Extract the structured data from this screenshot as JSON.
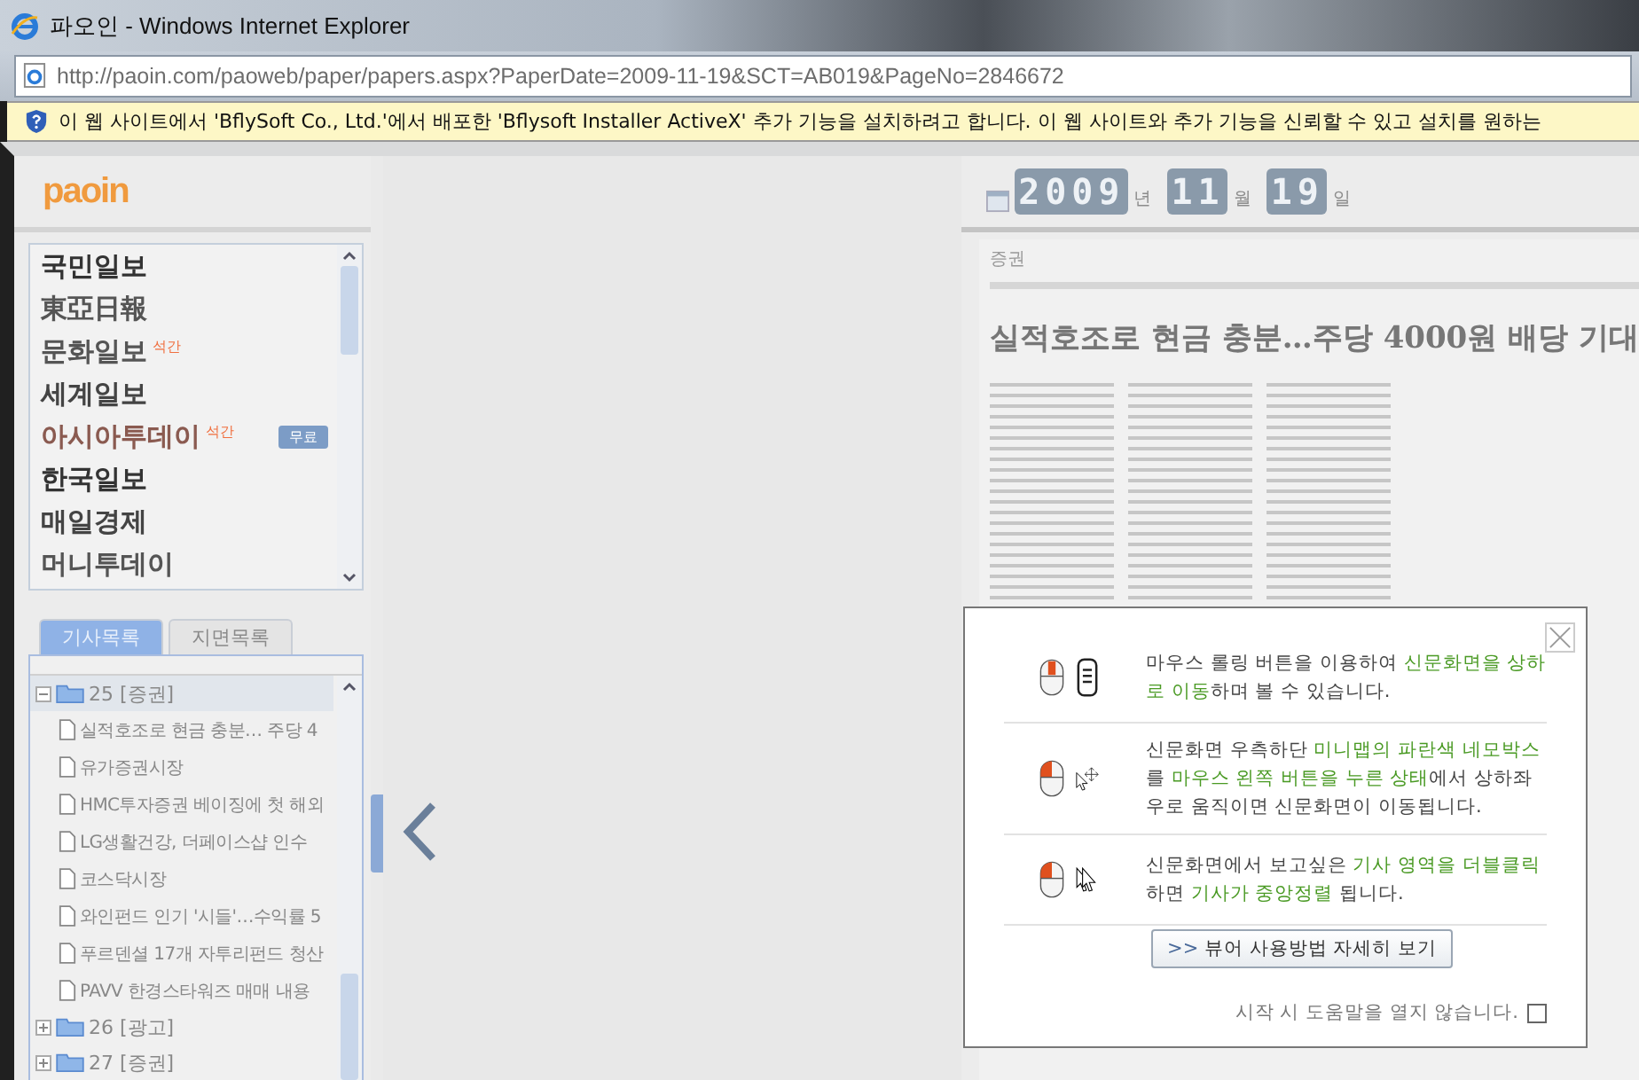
{
  "window": {
    "title": "파오인 - Windows Internet Explorer"
  },
  "address_bar": {
    "url": "http://paoin.com/paoweb/paper/papers.aspx?PaperDate=2009-11-19&SCT=AB019&PageNo=2846672"
  },
  "info_bar": {
    "text": "이 웹 사이트에서 'BflySoft Co., Ltd.'에서 배포한 'Bflysoft Installer ActiveX' 추가 기능을 설치하려고 합니다. 이 웹 사이트와 추가 기능을 신뢰할 수 있고 설치를 원하는"
  },
  "logo": {
    "text": "paoin"
  },
  "newspapers": [
    {
      "name": "국민일보",
      "color": "#333333"
    },
    {
      "name": "東亞日報",
      "color": "#555555"
    },
    {
      "name": "문화일보",
      "color": "#555555",
      "badge": "석간"
    },
    {
      "name": "세계일보",
      "color": "#444444"
    },
    {
      "name": "아시아투데이",
      "color": "#8a5a50",
      "badge": "석간",
      "tag": "무료"
    },
    {
      "name": "한국일보",
      "color": "#333333"
    },
    {
      "name": "매일경제",
      "color": "#444444"
    },
    {
      "name": "머니투데이",
      "color": "#555555"
    }
  ],
  "tabs": [
    {
      "label": "기사목록",
      "selected": true
    },
    {
      "label": "지면목록",
      "selected": false
    }
  ],
  "tree": [
    {
      "label": "25 [증권]",
      "expanded": true,
      "selected": true,
      "children": [
        {
          "label": "실적호조로 현금 충분… 주당 4"
        },
        {
          "label": "유가증권시장"
        },
        {
          "label": "HMC투자증권 베이징에 첫 해외"
        },
        {
          "label": "LG생활건강, 더페이스샵 인수"
        },
        {
          "label": "코스닥시장"
        },
        {
          "label": "와인펀드 인기 '시들'…수익률 5"
        },
        {
          "label": "푸르덴셜 17개 자투리펀드 청산"
        },
        {
          "label": "PAVV 한경스타워즈 매매 내용"
        }
      ]
    },
    {
      "label": "26 [광고]",
      "expanded": false,
      "selected": false
    },
    {
      "label": "27 [증권]",
      "expanded": false,
      "selected": false
    }
  ],
  "date": {
    "year": "2009",
    "year_unit": "년",
    "month": "11",
    "month_unit": "월",
    "day": "19",
    "day_unit": "일"
  },
  "page": {
    "section": "증권",
    "headline": "실적호조로 현금 충분…주당 4000원 배당 기대"
  },
  "help_popup": {
    "tips": [
      {
        "kind": "scroll",
        "text": "마우스 롤링 버튼을 이용하여 **신문화면을 상하로 이동**하며 볼 수 있습니다."
      },
      {
        "kind": "drag",
        "text": "신문화면 우측하단 **미니맵의 파란색 네모박스**를 **마우스 왼쪽 버튼을  누른 상태**에서 상하좌우로 움직이면 신문화면이 이동됩니다."
      },
      {
        "kind": "doubleclick",
        "text": "신문화면에서 보고싶은 **기사 영역을 더블클릭** 하면 **기사가 중앙정렬** 됩니다."
      }
    ],
    "button": "뷰어 사용방법 자세히 보기",
    "button_icon": ">>",
    "dont_show": {
      "label": "시작 시 도움말을 열지 않습니다.",
      "checked": false
    }
  }
}
